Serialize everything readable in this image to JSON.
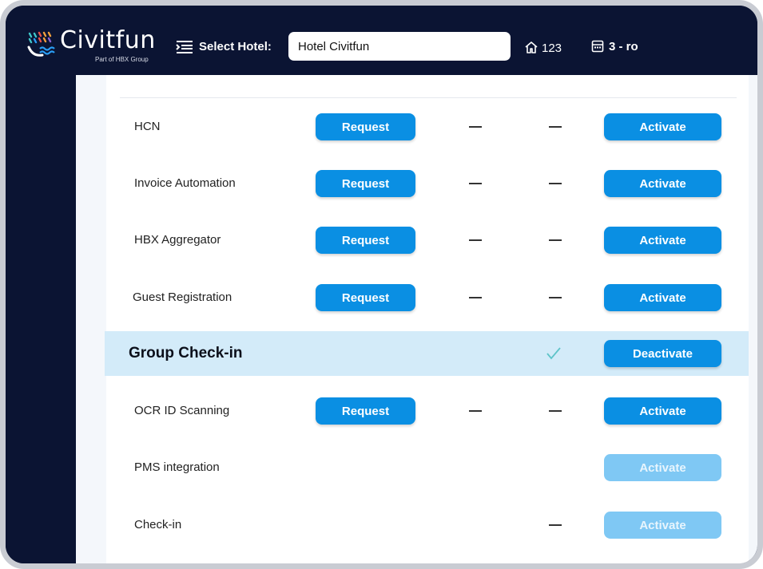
{
  "header": {
    "brand": "Civitfun",
    "brand_sub": "Part of HBX Group",
    "select_hotel_label": "Select Hotel:",
    "hotel_value": "Hotel Civitfun",
    "home_count": "123",
    "register_label": "3 - ro"
  },
  "icons": {
    "logo": "civitfun-logo",
    "select": "list-select-icon",
    "home": "home-icon",
    "register": "cash-register-icon",
    "check": "check-icon"
  },
  "colors": {
    "navy": "#0b1433",
    "primary_button": "#0a8fe3",
    "disabled_button": "#7fc8f4",
    "highlight_row": "#d3ebf9",
    "check": "#5ec4c9"
  },
  "rows": [
    {
      "label": "HCN",
      "request": "Request",
      "col1": "—",
      "col2": "—",
      "action": "Activate"
    },
    {
      "label": "Invoice Automation",
      "request": "Request",
      "col1": "—",
      "col2": "—",
      "action": "Activate"
    },
    {
      "label": "HBX Aggregator",
      "request": "Request",
      "col1": "—",
      "col2": "—",
      "action": "Activate"
    },
    {
      "label": "Guest Registration",
      "request": "Request",
      "col1": "—",
      "col2": "—",
      "action": "Activate"
    },
    {
      "label": "Group Check-in",
      "action": "Deactivate",
      "active": true
    },
    {
      "label": "OCR ID Scanning",
      "request": "Request",
      "col1": "—",
      "col2": "—",
      "action": "Activate"
    },
    {
      "label": "PMS integration",
      "action": "Activate",
      "disabled": true
    },
    {
      "label": "Check-in",
      "col2": "—",
      "action": "Activate",
      "disabled": true
    }
  ]
}
